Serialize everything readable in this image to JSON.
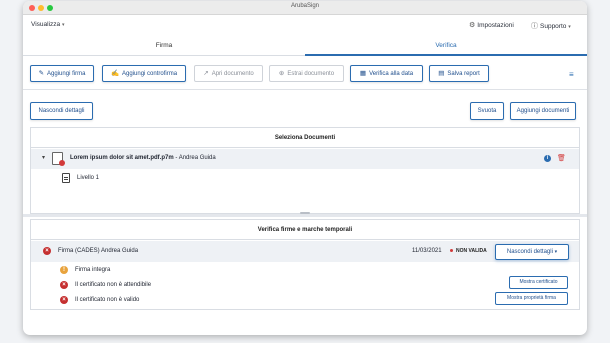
{
  "window": {
    "title": "ArubaSign"
  },
  "menu": {
    "visualizza": "Visualizza",
    "impostazioni": "Impostazioni",
    "supporto": "Supporto"
  },
  "tabs": [
    {
      "label": "Firma"
    },
    {
      "label": "Verifica"
    }
  ],
  "toolbar": {
    "aggiungi_firma": "Aggiungi firma",
    "aggiungi_controfirma": "Aggiungi controfirma",
    "apri_documento": "Apri documento",
    "estrai_documento": "Estrai documento",
    "verifica_alla_data": "Verifica alla data",
    "salva_report": "Salva report"
  },
  "actions": {
    "nascondi_dettagli": "Nascondi dettagli",
    "svuota": "Svuota",
    "aggiungi_documenti": "Aggiungi documenti"
  },
  "documents": {
    "title": "Seleziona Documenti",
    "file_name": "Lorem ipsum dolor sit amet.pdf.p7m",
    "author": " - Andrea Guida",
    "level": "Livello 1"
  },
  "verification": {
    "title": "Verifica firme e marche temporali",
    "signature": "Firma (CADES) Andrea Guida",
    "date": "11/03/2021",
    "status": "NON VALIDA",
    "status_color": "#d23a3a",
    "hide_details": "Nascondi dettagli",
    "checks": [
      {
        "label": "Firma integra",
        "icon": "warning-icon"
      },
      {
        "label": "Il certificato non è attendibile",
        "icon": "error-icon"
      },
      {
        "label": "Il certificato non è valido",
        "icon": "error-icon"
      }
    ],
    "show_certificate": "Mostra certificato",
    "show_signature_props": "Mostra proprietà firma"
  },
  "colors": {
    "accent": "#2b6cb0",
    "error": "#c53030",
    "warning": "#e8a33d"
  }
}
